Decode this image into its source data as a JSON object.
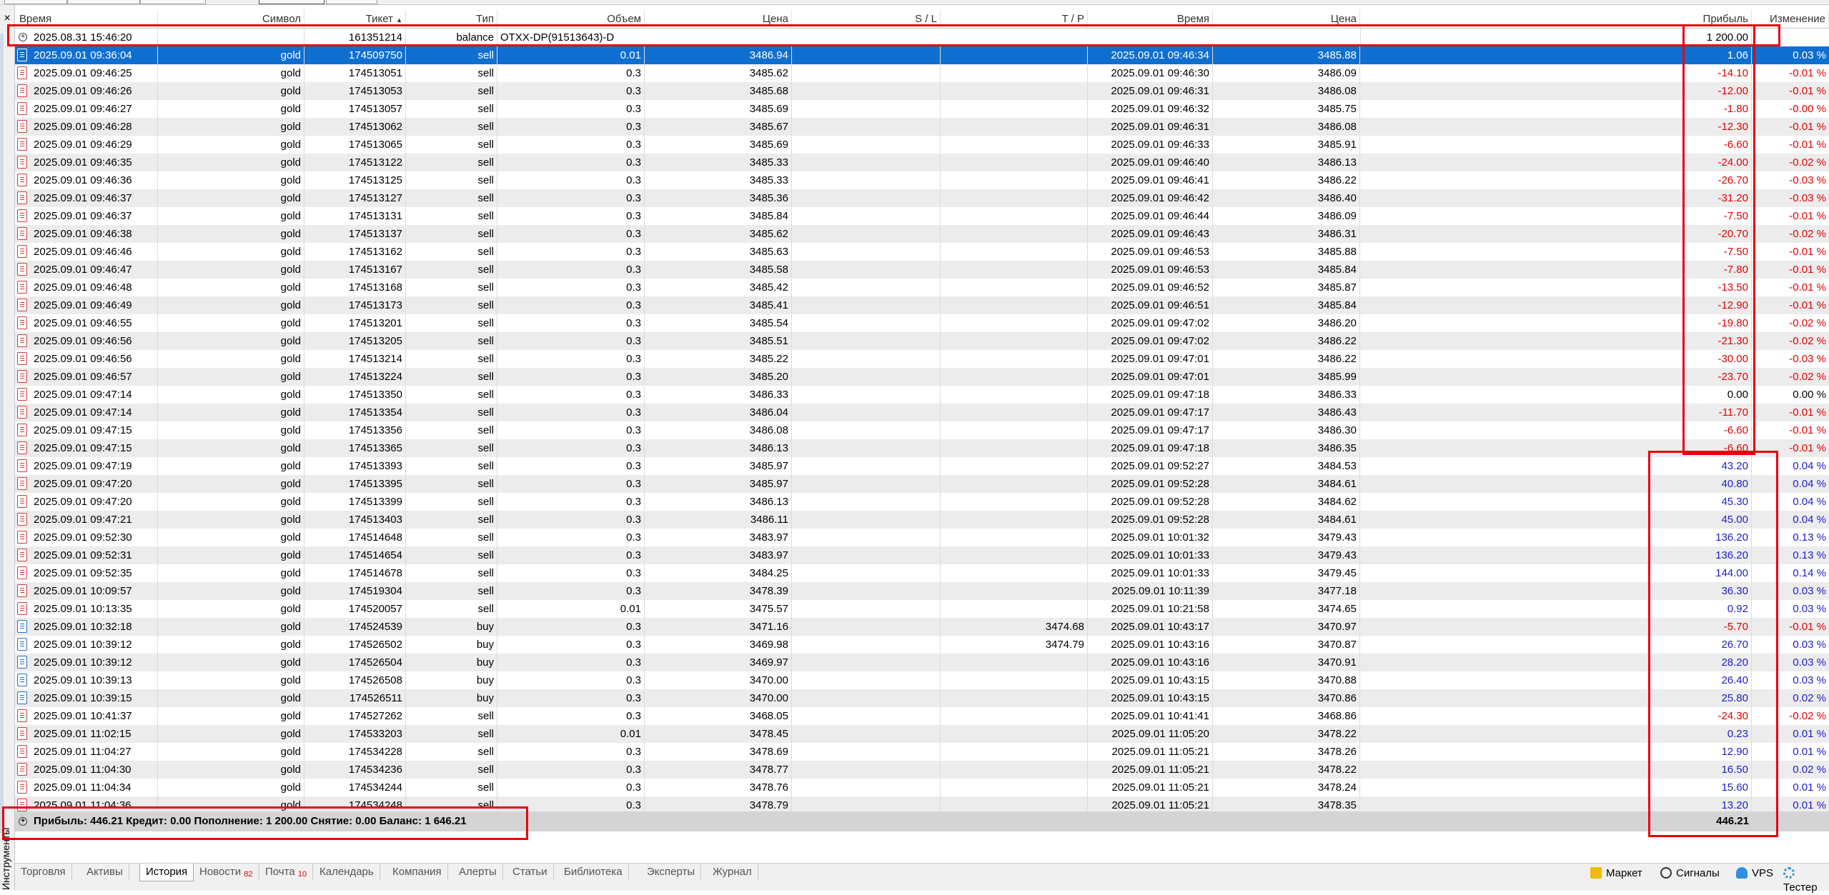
{
  "sidebar": {
    "close_glyph": "×",
    "vertical_tab": "Инструменты"
  },
  "columns": [
    "Время",
    "Символ",
    "Тикет",
    "Тип",
    "Объем",
    "Цена",
    "S / L",
    "T / P",
    "Время",
    "Цена",
    "Прибыль",
    "Изменение"
  ],
  "sort_indicator": "▲",
  "balance_row": {
    "time": "2025.08.31 15:46:20",
    "ticket": "161351214",
    "type": "balance",
    "comment": "OTXX-DP(91513643)-D",
    "profit": "1 200.00"
  },
  "trades": [
    {
      "open_time": "2025.09.01 09:36:04",
      "symbol": "gold",
      "ticket": "174509750",
      "type": "sell",
      "volume": "0.01",
      "open_price": "3486.94",
      "sl": "",
      "tp": "",
      "close_time": "2025.09.01 09:46:34",
      "close_price": "3485.88",
      "profit": "1.06",
      "change": "0.03 %",
      "sign": "pos"
    },
    {
      "open_time": "2025.09.01 09:46:25",
      "symbol": "gold",
      "ticket": "174513051",
      "type": "sell",
      "volume": "0.3",
      "open_price": "3485.62",
      "sl": "",
      "tp": "",
      "close_time": "2025.09.01 09:46:30",
      "close_price": "3486.09",
      "profit": "-14.10",
      "change": "-0.01 %",
      "sign": "neg"
    },
    {
      "open_time": "2025.09.01 09:46:26",
      "symbol": "gold",
      "ticket": "174513053",
      "type": "sell",
      "volume": "0.3",
      "open_price": "3485.68",
      "sl": "",
      "tp": "",
      "close_time": "2025.09.01 09:46:31",
      "close_price": "3486.08",
      "profit": "-12.00",
      "change": "-0.01 %",
      "sign": "neg"
    },
    {
      "open_time": "2025.09.01 09:46:27",
      "symbol": "gold",
      "ticket": "174513057",
      "type": "sell",
      "volume": "0.3",
      "open_price": "3485.69",
      "sl": "",
      "tp": "",
      "close_time": "2025.09.01 09:46:32",
      "close_price": "3485.75",
      "profit": "-1.80",
      "change": "-0.00 %",
      "sign": "neg"
    },
    {
      "open_time": "2025.09.01 09:46:28",
      "symbol": "gold",
      "ticket": "174513062",
      "type": "sell",
      "volume": "0.3",
      "open_price": "3485.67",
      "sl": "",
      "tp": "",
      "close_time": "2025.09.01 09:46:31",
      "close_price": "3486.08",
      "profit": "-12.30",
      "change": "-0.01 %",
      "sign": "neg"
    },
    {
      "open_time": "2025.09.01 09:46:29",
      "symbol": "gold",
      "ticket": "174513065",
      "type": "sell",
      "volume": "0.3",
      "open_price": "3485.69",
      "sl": "",
      "tp": "",
      "close_time": "2025.09.01 09:46:33",
      "close_price": "3485.91",
      "profit": "-6.60",
      "change": "-0.01 %",
      "sign": "neg"
    },
    {
      "open_time": "2025.09.01 09:46:35",
      "symbol": "gold",
      "ticket": "174513122",
      "type": "sell",
      "volume": "0.3",
      "open_price": "3485.33",
      "sl": "",
      "tp": "",
      "close_time": "2025.09.01 09:46:40",
      "close_price": "3486.13",
      "profit": "-24.00",
      "change": "-0.02 %",
      "sign": "neg"
    },
    {
      "open_time": "2025.09.01 09:46:36",
      "symbol": "gold",
      "ticket": "174513125",
      "type": "sell",
      "volume": "0.3",
      "open_price": "3485.33",
      "sl": "",
      "tp": "",
      "close_time": "2025.09.01 09:46:41",
      "close_price": "3486.22",
      "profit": "-26.70",
      "change": "-0.03 %",
      "sign": "neg"
    },
    {
      "open_time": "2025.09.01 09:46:37",
      "symbol": "gold",
      "ticket": "174513127",
      "type": "sell",
      "volume": "0.3",
      "open_price": "3485.36",
      "sl": "",
      "tp": "",
      "close_time": "2025.09.01 09:46:42",
      "close_price": "3486.40",
      "profit": "-31.20",
      "change": "-0.03 %",
      "sign": "neg"
    },
    {
      "open_time": "2025.09.01 09:46:37",
      "symbol": "gold",
      "ticket": "174513131",
      "type": "sell",
      "volume": "0.3",
      "open_price": "3485.84",
      "sl": "",
      "tp": "",
      "close_time": "2025.09.01 09:46:44",
      "close_price": "3486.09",
      "profit": "-7.50",
      "change": "-0.01 %",
      "sign": "neg"
    },
    {
      "open_time": "2025.09.01 09:46:38",
      "symbol": "gold",
      "ticket": "174513137",
      "type": "sell",
      "volume": "0.3",
      "open_price": "3485.62",
      "sl": "",
      "tp": "",
      "close_time": "2025.09.01 09:46:43",
      "close_price": "3486.31",
      "profit": "-20.70",
      "change": "-0.02 %",
      "sign": "neg"
    },
    {
      "open_time": "2025.09.01 09:46:46",
      "symbol": "gold",
      "ticket": "174513162",
      "type": "sell",
      "volume": "0.3",
      "open_price": "3485.63",
      "sl": "",
      "tp": "",
      "close_time": "2025.09.01 09:46:53",
      "close_price": "3485.88",
      "profit": "-7.50",
      "change": "-0.01 %",
      "sign": "neg"
    },
    {
      "open_time": "2025.09.01 09:46:47",
      "symbol": "gold",
      "ticket": "174513167",
      "type": "sell",
      "volume": "0.3",
      "open_price": "3485.58",
      "sl": "",
      "tp": "",
      "close_time": "2025.09.01 09:46:53",
      "close_price": "3485.84",
      "profit": "-7.80",
      "change": "-0.01 %",
      "sign": "neg"
    },
    {
      "open_time": "2025.09.01 09:46:48",
      "symbol": "gold",
      "ticket": "174513168",
      "type": "sell",
      "volume": "0.3",
      "open_price": "3485.42",
      "sl": "",
      "tp": "",
      "close_time": "2025.09.01 09:46:52",
      "close_price": "3485.87",
      "profit": "-13.50",
      "change": "-0.01 %",
      "sign": "neg"
    },
    {
      "open_time": "2025.09.01 09:46:49",
      "symbol": "gold",
      "ticket": "174513173",
      "type": "sell",
      "volume": "0.3",
      "open_price": "3485.41",
      "sl": "",
      "tp": "",
      "close_time": "2025.09.01 09:46:51",
      "close_price": "3485.84",
      "profit": "-12.90",
      "change": "-0.01 %",
      "sign": "neg"
    },
    {
      "open_time": "2025.09.01 09:46:55",
      "symbol": "gold",
      "ticket": "174513201",
      "type": "sell",
      "volume": "0.3",
      "open_price": "3485.54",
      "sl": "",
      "tp": "",
      "close_time": "2025.09.01 09:47:02",
      "close_price": "3486.20",
      "profit": "-19.80",
      "change": "-0.02 %",
      "sign": "neg"
    },
    {
      "open_time": "2025.09.01 09:46:56",
      "symbol": "gold",
      "ticket": "174513205",
      "type": "sell",
      "volume": "0.3",
      "open_price": "3485.51",
      "sl": "",
      "tp": "",
      "close_time": "2025.09.01 09:47:02",
      "close_price": "3486.22",
      "profit": "-21.30",
      "change": "-0.02 %",
      "sign": "neg"
    },
    {
      "open_time": "2025.09.01 09:46:56",
      "symbol": "gold",
      "ticket": "174513214",
      "type": "sell",
      "volume": "0.3",
      "open_price": "3485.22",
      "sl": "",
      "tp": "",
      "close_time": "2025.09.01 09:47:01",
      "close_price": "3486.22",
      "profit": "-30.00",
      "change": "-0.03 %",
      "sign": "neg"
    },
    {
      "open_time": "2025.09.01 09:46:57",
      "symbol": "gold",
      "ticket": "174513224",
      "type": "sell",
      "volume": "0.3",
      "open_price": "3485.20",
      "sl": "",
      "tp": "",
      "close_time": "2025.09.01 09:47:01",
      "close_price": "3485.99",
      "profit": "-23.70",
      "change": "-0.02 %",
      "sign": "neg"
    },
    {
      "open_time": "2025.09.01 09:47:14",
      "symbol": "gold",
      "ticket": "174513350",
      "type": "sell",
      "volume": "0.3",
      "open_price": "3486.33",
      "sl": "",
      "tp": "",
      "close_time": "2025.09.01 09:47:18",
      "close_price": "3486.33",
      "profit": "0.00",
      "change": "0.00 %",
      "sign": "zero"
    },
    {
      "open_time": "2025.09.01 09:47:14",
      "symbol": "gold",
      "ticket": "174513354",
      "type": "sell",
      "volume": "0.3",
      "open_price": "3486.04",
      "sl": "",
      "tp": "",
      "close_time": "2025.09.01 09:47:17",
      "close_price": "3486.43",
      "profit": "-11.70",
      "change": "-0.01 %",
      "sign": "neg"
    },
    {
      "open_time": "2025.09.01 09:47:15",
      "symbol": "gold",
      "ticket": "174513356",
      "type": "sell",
      "volume": "0.3",
      "open_price": "3486.08",
      "sl": "",
      "tp": "",
      "close_time": "2025.09.01 09:47:17",
      "close_price": "3486.30",
      "profit": "-6.60",
      "change": "-0.01 %",
      "sign": "neg"
    },
    {
      "open_time": "2025.09.01 09:47:15",
      "symbol": "gold",
      "ticket": "174513365",
      "type": "sell",
      "volume": "0.3",
      "open_price": "3486.13",
      "sl": "",
      "tp": "",
      "close_time": "2025.09.01 09:47:18",
      "close_price": "3486.35",
      "profit": "-6.60",
      "change": "-0.01 %",
      "sign": "neg"
    },
    {
      "open_time": "2025.09.01 09:47:19",
      "symbol": "gold",
      "ticket": "174513393",
      "type": "sell",
      "volume": "0.3",
      "open_price": "3485.97",
      "sl": "",
      "tp": "",
      "close_time": "2025.09.01 09:52:27",
      "close_price": "3484.53",
      "profit": "43.20",
      "change": "0.04 %",
      "sign": "pos"
    },
    {
      "open_time": "2025.09.01 09:47:20",
      "symbol": "gold",
      "ticket": "174513395",
      "type": "sell",
      "volume": "0.3",
      "open_price": "3485.97",
      "sl": "",
      "tp": "",
      "close_time": "2025.09.01 09:52:28",
      "close_price": "3484.61",
      "profit": "40.80",
      "change": "0.04 %",
      "sign": "pos"
    },
    {
      "open_time": "2025.09.01 09:47:20",
      "symbol": "gold",
      "ticket": "174513399",
      "type": "sell",
      "volume": "0.3",
      "open_price": "3486.13",
      "sl": "",
      "tp": "",
      "close_time": "2025.09.01 09:52:28",
      "close_price": "3484.62",
      "profit": "45.30",
      "change": "0.04 %",
      "sign": "pos"
    },
    {
      "open_time": "2025.09.01 09:47:21",
      "symbol": "gold",
      "ticket": "174513403",
      "type": "sell",
      "volume": "0.3",
      "open_price": "3486.11",
      "sl": "",
      "tp": "",
      "close_time": "2025.09.01 09:52:28",
      "close_price": "3484.61",
      "profit": "45.00",
      "change": "0.04 %",
      "sign": "pos"
    },
    {
      "open_time": "2025.09.01 09:52:30",
      "symbol": "gold",
      "ticket": "174514648",
      "type": "sell",
      "volume": "0.3",
      "open_price": "3483.97",
      "sl": "",
      "tp": "",
      "close_time": "2025.09.01 10:01:32",
      "close_price": "3479.43",
      "profit": "136.20",
      "change": "0.13 %",
      "sign": "pos"
    },
    {
      "open_time": "2025.09.01 09:52:31",
      "symbol": "gold",
      "ticket": "174514654",
      "type": "sell",
      "volume": "0.3",
      "open_price": "3483.97",
      "sl": "",
      "tp": "",
      "close_time": "2025.09.01 10:01:33",
      "close_price": "3479.43",
      "profit": "136.20",
      "change": "0.13 %",
      "sign": "pos"
    },
    {
      "open_time": "2025.09.01 09:52:35",
      "symbol": "gold",
      "ticket": "174514678",
      "type": "sell",
      "volume": "0.3",
      "open_price": "3484.25",
      "sl": "",
      "tp": "",
      "close_time": "2025.09.01 10:01:33",
      "close_price": "3479.45",
      "profit": "144.00",
      "change": "0.14 %",
      "sign": "pos"
    },
    {
      "open_time": "2025.09.01 10:09:57",
      "symbol": "gold",
      "ticket": "174519304",
      "type": "sell",
      "volume": "0.3",
      "open_price": "3478.39",
      "sl": "",
      "tp": "",
      "close_time": "2025.09.01 10:11:39",
      "close_price": "3477.18",
      "profit": "36.30",
      "change": "0.03 %",
      "sign": "pos"
    },
    {
      "open_time": "2025.09.01 10:13:35",
      "symbol": "gold",
      "ticket": "174520057",
      "type": "sell",
      "volume": "0.01",
      "open_price": "3475.57",
      "sl": "",
      "tp": "",
      "close_time": "2025.09.01 10:21:58",
      "close_price": "3474.65",
      "profit": "0.92",
      "change": "0.03 %",
      "sign": "pos"
    },
    {
      "open_time": "2025.09.01 10:32:18",
      "symbol": "gold",
      "ticket": "174524539",
      "type": "buy",
      "volume": "0.3",
      "open_price": "3471.16",
      "sl": "",
      "tp": "3474.68",
      "close_time": "2025.09.01 10:43:17",
      "close_price": "3470.97",
      "profit": "-5.70",
      "change": "-0.01 %",
      "sign": "neg"
    },
    {
      "open_time": "2025.09.01 10:39:12",
      "symbol": "gold",
      "ticket": "174526502",
      "type": "buy",
      "volume": "0.3",
      "open_price": "3469.98",
      "sl": "",
      "tp": "3474.79",
      "close_time": "2025.09.01 10:43:16",
      "close_price": "3470.87",
      "profit": "26.70",
      "change": "0.03 %",
      "sign": "pos"
    },
    {
      "open_time": "2025.09.01 10:39:12",
      "symbol": "gold",
      "ticket": "174526504",
      "type": "buy",
      "volume": "0.3",
      "open_price": "3469.97",
      "sl": "",
      "tp": "",
      "close_time": "2025.09.01 10:43:16",
      "close_price": "3470.91",
      "profit": "28.20",
      "change": "0.03 %",
      "sign": "pos"
    },
    {
      "open_time": "2025.09.01 10:39:13",
      "symbol": "gold",
      "ticket": "174526508",
      "type": "buy",
      "volume": "0.3",
      "open_price": "3470.00",
      "sl": "",
      "tp": "",
      "close_time": "2025.09.01 10:43:15",
      "close_price": "3470.88",
      "profit": "26.40",
      "change": "0.03 %",
      "sign": "pos"
    },
    {
      "open_time": "2025.09.01 10:39:15",
      "symbol": "gold",
      "ticket": "174526511",
      "type": "buy",
      "volume": "0.3",
      "open_price": "3470.00",
      "sl": "",
      "tp": "",
      "close_time": "2025.09.01 10:43:15",
      "close_price": "3470.86",
      "profit": "25.80",
      "change": "0.02 %",
      "sign": "pos"
    },
    {
      "open_time": "2025.09.01 10:41:37",
      "symbol": "gold",
      "ticket": "174527262",
      "type": "sell",
      "volume": "0.3",
      "open_price": "3468.05",
      "sl": "",
      "tp": "",
      "close_time": "2025.09.01 10:41:41",
      "close_price": "3468.86",
      "profit": "-24.30",
      "change": "-0.02 %",
      "sign": "neg"
    },
    {
      "open_time": "2025.09.01 11:02:15",
      "symbol": "gold",
      "ticket": "174533203",
      "type": "sell",
      "volume": "0.01",
      "open_price": "3478.45",
      "sl": "",
      "tp": "",
      "close_time": "2025.09.01 11:05:20",
      "close_price": "3478.22",
      "profit": "0.23",
      "change": "0.01 %",
      "sign": "pos"
    },
    {
      "open_time": "2025.09.01 11:04:27",
      "symbol": "gold",
      "ticket": "174534228",
      "type": "sell",
      "volume": "0.3",
      "open_price": "3478.69",
      "sl": "",
      "tp": "",
      "close_time": "2025.09.01 11:05:21",
      "close_price": "3478.26",
      "profit": "12.90",
      "change": "0.01 %",
      "sign": "pos"
    },
    {
      "open_time": "2025.09.01 11:04:30",
      "symbol": "gold",
      "ticket": "174534236",
      "type": "sell",
      "volume": "0.3",
      "open_price": "3478.77",
      "sl": "",
      "tp": "",
      "close_time": "2025.09.01 11:05:21",
      "close_price": "3478.22",
      "profit": "16.50",
      "change": "0.02 %",
      "sign": "pos"
    },
    {
      "open_time": "2025.09.01 11:04:34",
      "symbol": "gold",
      "ticket": "174534244",
      "type": "sell",
      "volume": "0.3",
      "open_price": "3478.76",
      "sl": "",
      "tp": "",
      "close_time": "2025.09.01 11:05:21",
      "close_price": "3478.24",
      "profit": "15.60",
      "change": "0.01 %",
      "sign": "pos"
    },
    {
      "open_time": "2025.09.01 11:04:36",
      "symbol": "gold",
      "ticket": "174534248",
      "type": "sell",
      "volume": "0.3",
      "open_price": "3478.79",
      "sl": "",
      "tp": "",
      "close_time": "2025.09.01 11:05:21",
      "close_price": "3478.35",
      "profit": "13.20",
      "change": "0.01 %",
      "sign": "pos"
    }
  ],
  "summary": {
    "text": "Прибыль: 446.21  Кредит: 0.00  Пополнение: 1 200.00  Снятие: 0.00  Баланс: 1 646.21",
    "total": "446.21"
  },
  "bottom_tabs": [
    {
      "label": "Торговля",
      "badge": ""
    },
    {
      "label": "Активы",
      "badge": ""
    },
    {
      "label": "История",
      "badge": "",
      "active": true
    },
    {
      "label": "Новости",
      "badge": "82"
    },
    {
      "label": "Почта",
      "badge": "10"
    },
    {
      "label": "Календарь",
      "badge": ""
    },
    {
      "label": "Компания",
      "badge": ""
    },
    {
      "label": "Алерты",
      "badge": ""
    },
    {
      "label": "Статьи",
      "badge": ""
    },
    {
      "label": "Библиотека",
      "badge": ""
    },
    {
      "label": "Эксперты",
      "badge": ""
    },
    {
      "label": "Журнал",
      "badge": ""
    }
  ],
  "right_tools": [
    {
      "label": "Маркет",
      "icon": "bag-icon"
    },
    {
      "label": "Сигналы",
      "icon": "signals-icon"
    },
    {
      "label": "VPS",
      "icon": "cloud-icon"
    },
    {
      "label": "Тестер",
      "icon": "gear-icon"
    }
  ],
  "colors": {
    "selected_row": "#0f6fd1",
    "negative": "#e30000",
    "positive": "#1c1ccf",
    "zebra": "#ececec",
    "summary_bg": "#d4d4d4",
    "highlight_box": "#e8000e"
  }
}
